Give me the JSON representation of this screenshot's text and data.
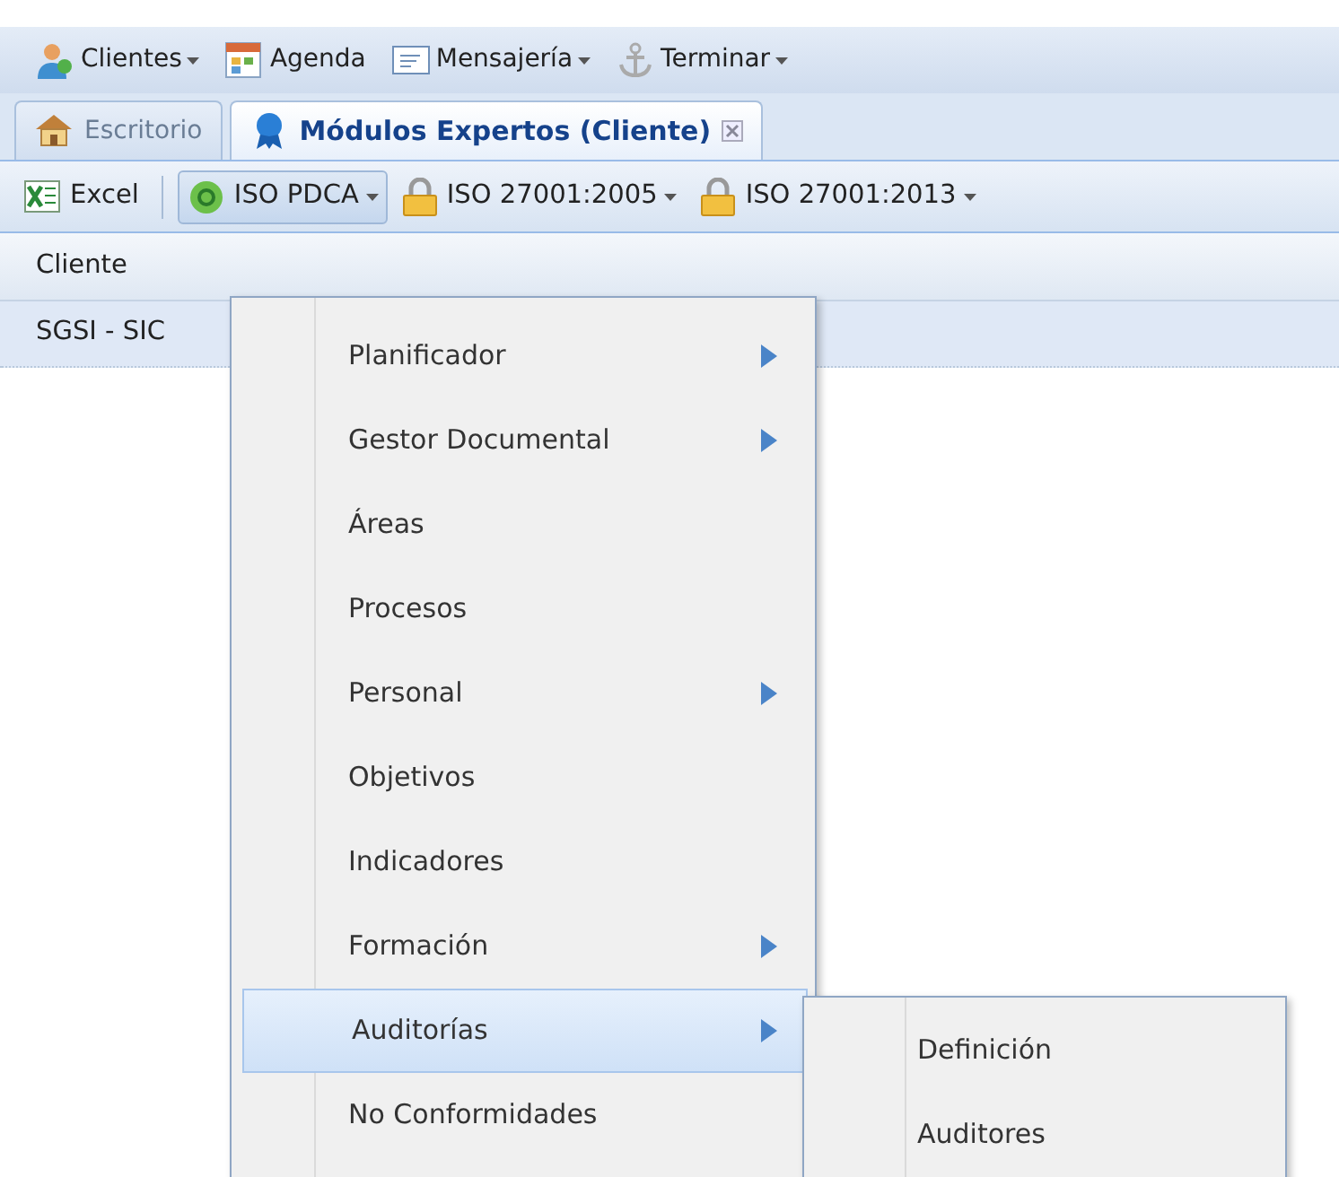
{
  "top_menu": [
    {
      "label": "Clientes",
      "dropdown": true
    },
    {
      "label": "Agenda",
      "dropdown": false
    },
    {
      "label": "Mensajería",
      "dropdown": true
    },
    {
      "label": "Terminar",
      "dropdown": true
    }
  ],
  "tabs": [
    {
      "label": "Escritorio",
      "selected": false,
      "closable": false
    },
    {
      "label": "Módulos Expertos (Cliente)",
      "selected": true,
      "closable": true
    }
  ],
  "toolbar": [
    {
      "label": "Excel",
      "dropdown": false,
      "pressed": false
    },
    {
      "label": "ISO PDCA",
      "dropdown": true,
      "pressed": true
    },
    {
      "label": "ISO 27001:2005",
      "dropdown": true,
      "pressed": false
    },
    {
      "label": "ISO 27001:2013",
      "dropdown": true,
      "pressed": false
    }
  ],
  "grid": {
    "columns": [
      "Cliente"
    ],
    "rows": [
      [
        "SGSI - SIC"
      ]
    ]
  },
  "menu": {
    "items": [
      {
        "label": "Planificador",
        "has_submenu": true,
        "selected": false
      },
      {
        "label": "Gestor Documental",
        "has_submenu": true,
        "selected": false
      },
      {
        "label": "Áreas",
        "has_submenu": false,
        "selected": false
      },
      {
        "label": "Procesos",
        "has_submenu": false,
        "selected": false
      },
      {
        "label": "Personal",
        "has_submenu": true,
        "selected": false
      },
      {
        "label": "Objetivos",
        "has_submenu": false,
        "selected": false
      },
      {
        "label": "Indicadores",
        "has_submenu": false,
        "selected": false
      },
      {
        "label": "Formación",
        "has_submenu": true,
        "selected": false
      },
      {
        "label": "Auditorías",
        "has_submenu": true,
        "selected": true
      },
      {
        "label": "No Conformidades",
        "has_submenu": false,
        "selected": false
      }
    ],
    "submenu": {
      "items": [
        {
          "label": "Definición",
          "selected": false
        },
        {
          "label": "Auditores",
          "selected": false
        }
      ]
    }
  }
}
